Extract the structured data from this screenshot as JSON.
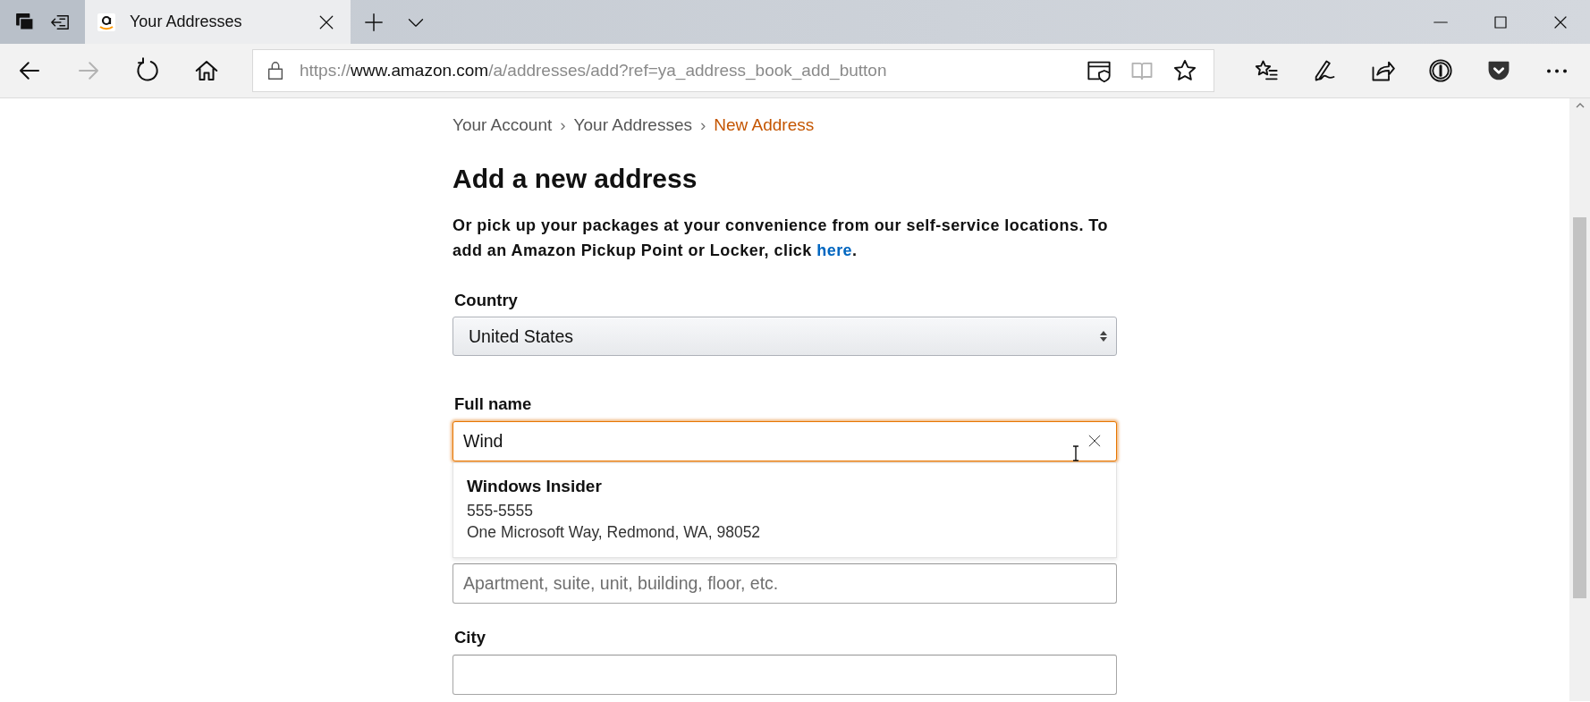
{
  "browser": {
    "tabs": [
      {
        "title": "Your Addresses",
        "selected": true
      }
    ],
    "nav_buttons": [
      {
        "kind": "back",
        "disabled": false
      },
      {
        "kind": "forward",
        "disabled": true
      },
      {
        "kind": "refresh",
        "disabled": false
      },
      {
        "kind": "home",
        "disabled": false
      }
    ],
    "address_bar": {
      "scheme": "https://",
      "host": "www.amazon.com",
      "path": "/a/addresses/add?ref=ya_address_book_add_button"
    },
    "address_bar_buttons": [
      {
        "kind": "tracking",
        "disabled": false
      },
      {
        "kind": "reading-view",
        "disabled": true
      },
      {
        "kind": "favorite",
        "disabled": false
      }
    ],
    "toolbar_buttons": [
      {
        "kind": "favorites"
      },
      {
        "kind": "notes"
      },
      {
        "kind": "share"
      },
      {
        "kind": "password"
      },
      {
        "kind": "pocket"
      },
      {
        "kind": "more"
      }
    ]
  },
  "page": {
    "breadcrumb": [
      {
        "label": "Your Account",
        "separator": "›",
        "current": false
      },
      {
        "label": "Your Addresses",
        "separator": "›",
        "current": false
      },
      {
        "label": "New Address",
        "current": true
      }
    ],
    "heading": "Add a new address",
    "intro": {
      "text": "Or pick up your packages at your convenience from our self-service locations. To add an Amazon Pickup Point or Locker, click ",
      "link": "here",
      "end": "."
    },
    "fields": [
      {
        "kind": "select",
        "label": "Country",
        "value": "United States"
      },
      {
        "kind": "text",
        "label": "Full name",
        "value": "Wind",
        "focused": true,
        "clearable": true,
        "suggestions": [
          {
            "name": "Windows Insider",
            "phone": "555-5555",
            "address": "One Microsoft Way, Redmond, WA, 98052"
          }
        ]
      },
      {
        "kind": "text",
        "placeholder": "Apartment, suite, unit, building, floor, etc.",
        "focused": false,
        "clearable": false
      },
      {
        "kind": "text",
        "label": "City",
        "focused": false,
        "clearable": false
      }
    ]
  }
}
